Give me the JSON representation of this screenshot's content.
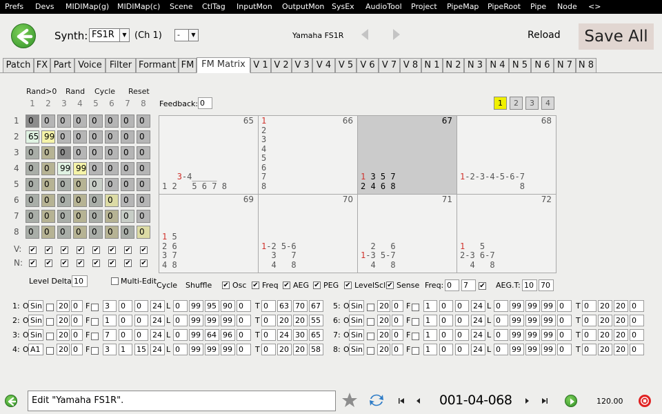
{
  "menu": [
    "Prefs",
    "Devs",
    "MIDIMap(g)",
    "MIDIMap(c)",
    "Scene",
    "CtlTag",
    "InputMon",
    "OutputMon",
    "SysEx",
    "AudioTool",
    "Project",
    "PipeMap",
    "PipeRoot",
    "Pipe",
    "Node",
    "<>"
  ],
  "header": {
    "synth_label": "Synth:",
    "synth_value": "FS1R",
    "channel": "(Ch 1)",
    "channel_select": "-",
    "device_name": "Yamaha FS1R",
    "reload": "Reload",
    "save_all": "Save All"
  },
  "tabs": [
    "Patch",
    "FX",
    "Part",
    "Voice",
    "Filter",
    "Formant",
    "FM",
    "FM Matrix",
    "V 1",
    "V 2",
    "V 3",
    "V 4",
    "V 5",
    "V 6",
    "V 7",
    "V 8",
    "N 1",
    "N 2",
    "N 3",
    "N 4",
    "N 5",
    "N 6",
    "N 7",
    "N 8"
  ],
  "active_tab": "FM Matrix",
  "matrix": {
    "headers": [
      "Rand>0",
      "Rand",
      "Cycle",
      "Reset"
    ],
    "col_numbers": [
      "1",
      "2",
      "3",
      "4",
      "5",
      "6",
      "7",
      "8"
    ],
    "row_numbers": [
      "1:",
      "2:",
      "3:",
      "4:",
      "5:",
      "6:",
      "7:",
      "8:"
    ],
    "values": [
      [
        "0",
        "0",
        "0",
        "0",
        "0",
        "0",
        "0",
        "0"
      ],
      [
        "65",
        "99",
        "0",
        "0",
        "0",
        "0",
        "0",
        "0"
      ],
      [
        "0",
        "0",
        "0",
        "0",
        "0",
        "0",
        "0",
        "0"
      ],
      [
        "0",
        "0",
        "99",
        "99",
        "0",
        "0",
        "0",
        "0"
      ],
      [
        "0",
        "0",
        "0",
        "0",
        "0",
        "0",
        "0",
        "0"
      ],
      [
        "0",
        "0",
        "0",
        "0",
        "0",
        "0",
        "0",
        "0"
      ],
      [
        "0",
        "0",
        "0",
        "0",
        "0",
        "0",
        "0",
        "0"
      ],
      [
        "0",
        "0",
        "0",
        "0",
        "0",
        "0",
        "0",
        "0"
      ]
    ],
    "v_label": "V:",
    "n_label": "N:"
  },
  "feedback": {
    "label": "Feedback:",
    "value": "0"
  },
  "pages": [
    "1",
    "2",
    "3",
    "4"
  ],
  "algorithms": [
    {
      "num": "65",
      "lines": [
        " ",
        " ",
        " ",
        " ",
        " ",
        " ",
        "   3-4_____",
        "1 2   5 6 7 8"
      ]
    },
    {
      "num": "66",
      "lines": [
        "1",
        "2",
        "3",
        "4",
        "5",
        "6",
        "7",
        "8"
      ]
    },
    {
      "num": "67",
      "lines": [
        " ",
        " ",
        " ",
        " ",
        " ",
        " ",
        "1 3 5 7",
        "2 4 6 8"
      ]
    },
    {
      "num": "68",
      "lines": [
        " ",
        " ",
        " ",
        " ",
        " ",
        " ",
        "1-2-3-4-5-6-7",
        "            8"
      ]
    },
    {
      "num": "69",
      "lines": [
        " ",
        " ",
        " ",
        " ",
        "1 5",
        "2 6",
        "3 7",
        "4 8"
      ]
    },
    {
      "num": "70",
      "lines": [
        " ",
        " ",
        " ",
        " ",
        " ",
        "1-2 5-6",
        "  3   7",
        "  4   8"
      ]
    },
    {
      "num": "71",
      "lines": [
        " ",
        " ",
        " ",
        " ",
        " ",
        "  2   6",
        "1-3 5-7",
        "  4   8"
      ]
    },
    {
      "num": "72",
      "lines": [
        " ",
        " ",
        " ",
        " ",
        " ",
        "1   5",
        "2-3 6-7",
        "  4   8"
      ]
    }
  ],
  "controls": {
    "level_delta_label": "Level Delta:",
    "level_delta": "10",
    "multi_edit": "Multi-Edit",
    "cycle": "Cycle",
    "shuffle": "Shuffle",
    "toggles": [
      "Osc",
      "Freq",
      "AEG",
      "PEG",
      "LevelScl",
      "Sense"
    ],
    "freq_label": "Freq:",
    "freq_a": "0",
    "freq_b": "7",
    "aeg_t_label": "AEG.T:",
    "aeg_t_a": "10",
    "aeg_t_b": "70"
  },
  "operators": [
    {
      "id": "1:",
      "mode": "O",
      "wave": "Sin",
      "a": "20",
      "b": "0",
      "f1": "3",
      "f2": "0",
      "f3": "0",
      "f4": "24",
      "l": [
        "0",
        "99",
        "95",
        "90",
        "0"
      ],
      "t": [
        "0",
        "63",
        "70",
        "67"
      ]
    },
    {
      "id": "2:",
      "mode": "O",
      "wave": "Sin",
      "a": "20",
      "b": "0",
      "f1": "1",
      "f2": "0",
      "f3": "0",
      "f4": "24",
      "l": [
        "0",
        "99",
        "99",
        "99",
        "0"
      ],
      "t": [
        "0",
        "20",
        "20",
        "55"
      ]
    },
    {
      "id": "3:",
      "mode": "O",
      "wave": "Sin",
      "a": "20",
      "b": "0",
      "f1": "7",
      "f2": "0",
      "f3": "0",
      "f4": "24",
      "l": [
        "0",
        "99",
        "64",
        "96",
        "0"
      ],
      "t": [
        "0",
        "24",
        "30",
        "65"
      ]
    },
    {
      "id": "4:",
      "mode": "O",
      "wave": "A1",
      "a": "20",
      "b": "0",
      "f1": "3",
      "f2": "1",
      "f3": "15",
      "f4": "24",
      "l": [
        "0",
        "99",
        "99",
        "99",
        "0"
      ],
      "t": [
        "0",
        "20",
        "20",
        "58"
      ]
    },
    {
      "id": "5:",
      "mode": "O",
      "wave": "Sin",
      "a": "20",
      "b": "0",
      "f1": "1",
      "f2": "0",
      "f3": "0",
      "f4": "24",
      "l": [
        "0",
        "99",
        "99",
        "99",
        "0"
      ],
      "t": [
        "0",
        "20",
        "20",
        "0"
      ]
    },
    {
      "id": "6:",
      "mode": "O",
      "wave": "Sin",
      "a": "20",
      "b": "0",
      "f1": "1",
      "f2": "0",
      "f3": "0",
      "f4": "24",
      "l": [
        "0",
        "99",
        "99",
        "99",
        "0"
      ],
      "t": [
        "0",
        "20",
        "20",
        "0"
      ]
    },
    {
      "id": "7:",
      "mode": "O",
      "wave": "Sin",
      "a": "20",
      "b": "0",
      "f1": "1",
      "f2": "0",
      "f3": "0",
      "f4": "24",
      "l": [
        "0",
        "99",
        "99",
        "99",
        "0"
      ],
      "t": [
        "0",
        "20",
        "20",
        "0"
      ]
    },
    {
      "id": "8:",
      "mode": "O",
      "wave": "Sin",
      "a": "20",
      "b": "0",
      "f1": "1",
      "f2": "0",
      "f3": "0",
      "f4": "24",
      "l": [
        "0",
        "99",
        "99",
        "99",
        "0"
      ],
      "t": [
        "0",
        "20",
        "20",
        "0"
      ]
    }
  ],
  "op_labels": {
    "f": "F",
    "l": "L",
    "t": "T"
  },
  "status": {
    "message": "Edit \"Yamaha FS1R\".",
    "counter": "001-04-068",
    "tempo": "120.00"
  }
}
